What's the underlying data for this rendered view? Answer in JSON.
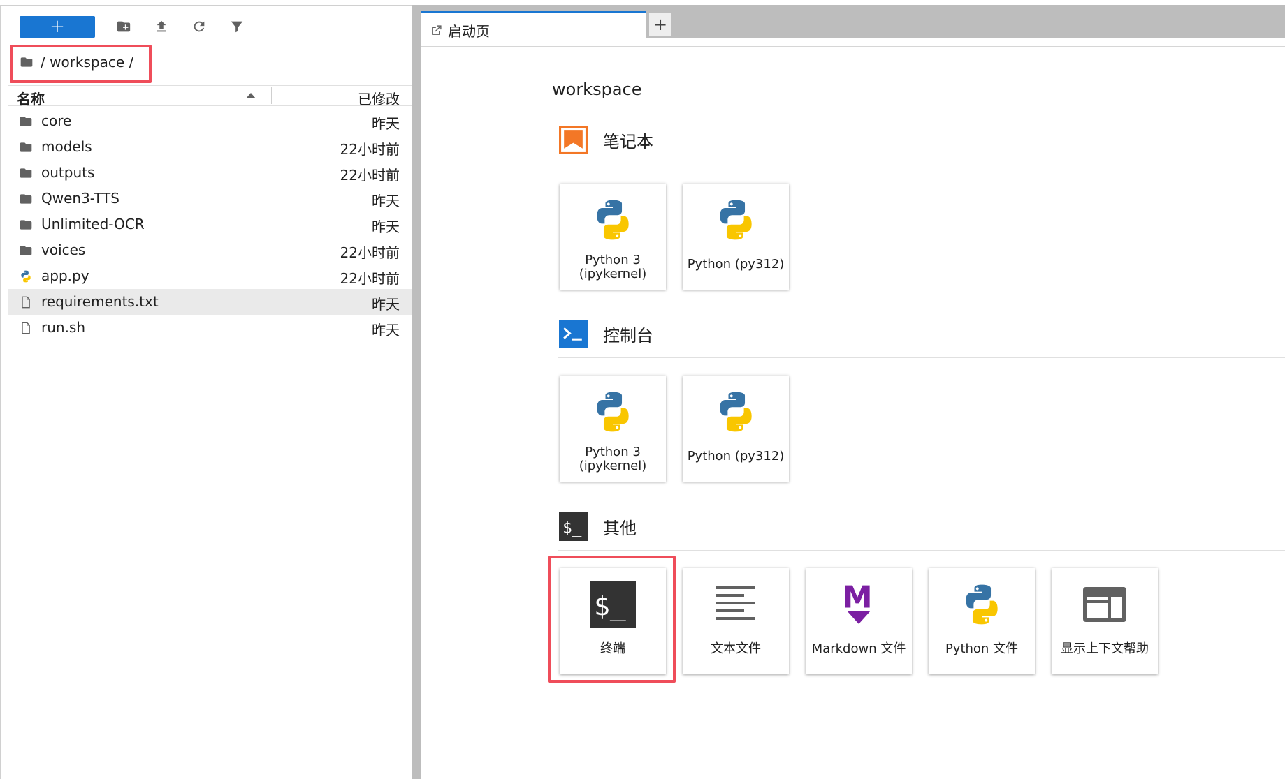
{
  "toolbar": {
    "new_label": "+",
    "icons": [
      "new-folder-icon",
      "upload-icon",
      "refresh-icon",
      "filter-icon"
    ]
  },
  "breadcrumb": {
    "path": "/ workspace /"
  },
  "file_list": {
    "header_name": "名称",
    "header_modified": "已修改",
    "rows": [
      {
        "name": "core",
        "modified": "昨天",
        "icon": "folder-icon"
      },
      {
        "name": "models",
        "modified": "22小时前",
        "icon": "folder-icon"
      },
      {
        "name": "outputs",
        "modified": "22小时前",
        "icon": "folder-icon"
      },
      {
        "name": "Qwen3-TTS",
        "modified": "昨天",
        "icon": "folder-icon"
      },
      {
        "name": "Unlimited-OCR",
        "modified": "昨天",
        "icon": "folder-icon"
      },
      {
        "name": "voices",
        "modified": "22小时前",
        "icon": "folder-icon"
      },
      {
        "name": "app.py",
        "modified": "22小时前",
        "icon": "python-file-icon"
      },
      {
        "name": "requirements.txt",
        "modified": "昨天",
        "icon": "text-file-icon",
        "selected": true
      },
      {
        "name": "run.sh",
        "modified": "昨天",
        "icon": "text-file-icon"
      }
    ]
  },
  "tabs": {
    "launcher_label": "启动页",
    "add_label": "+"
  },
  "launcher": {
    "title": "workspace",
    "sections": {
      "notebook": {
        "title": "笔记本",
        "cards": [
          "Python 3\n(ipykernel)",
          "Python (py312)"
        ]
      },
      "console": {
        "title": "控制台",
        "cards": [
          "Python 3\n(ipykernel)",
          "Python (py312)"
        ]
      },
      "other": {
        "title": "其他",
        "cards": [
          "终端",
          "文本文件",
          "Markdown 文件",
          "Python 文件",
          "显示上下文帮助"
        ]
      }
    }
  },
  "colors": {
    "accent": "#1976d2",
    "highlight": "#ef4d5a",
    "notebook_orange": "#f37726",
    "markdown_purple": "#7b1fa2"
  }
}
